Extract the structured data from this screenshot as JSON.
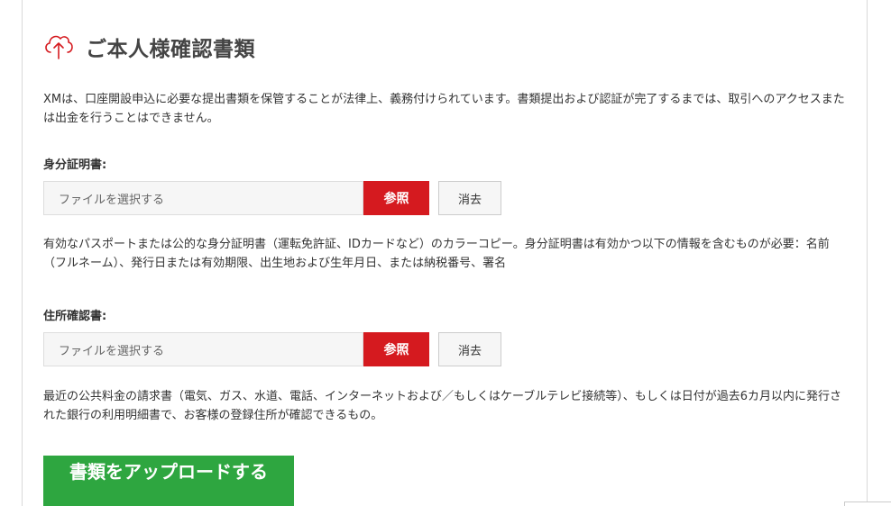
{
  "header": {
    "icon": "cloud-upload-icon",
    "title": "ご本人様確認書類",
    "accent_color": "#d51a1f"
  },
  "intro_text": "XMは、口座開設申込に必要な提出書類を保管することが法律上、義務付けられています。書類提出および認証が完了するまでは、取引へのアクセスまたは出金を行うことはできません。",
  "id_document": {
    "label": "身分証明書:",
    "file_placeholder": "ファイルを選択する",
    "browse_label": "参照",
    "clear_label": "消去",
    "description": "有効なパスポートまたは公的な身分証明書（運転免許証、IDカードなど）のカラーコピー。身分証明書は有効かつ以下の情報を含むものが必要：名前（フルネーム）、発行日または有効期限、出生地および生年月日、または納税番号、署名"
  },
  "address_document": {
    "label": "住所確認書:",
    "file_placeholder": "ファイルを選択する",
    "browse_label": "参照",
    "clear_label": "消去",
    "description": "最近の公共料金の請求書（電気、ガス、水道、電話、インターネットおよび／もしくはケーブルテレビ接続等）、もしくは日付が過去6カ月以内に発行された銀行の利用明細書で、お客様の登録住所が確認できるもの。"
  },
  "upload_button": {
    "label": "書類をアップロードする",
    "color": "#2ea640"
  }
}
